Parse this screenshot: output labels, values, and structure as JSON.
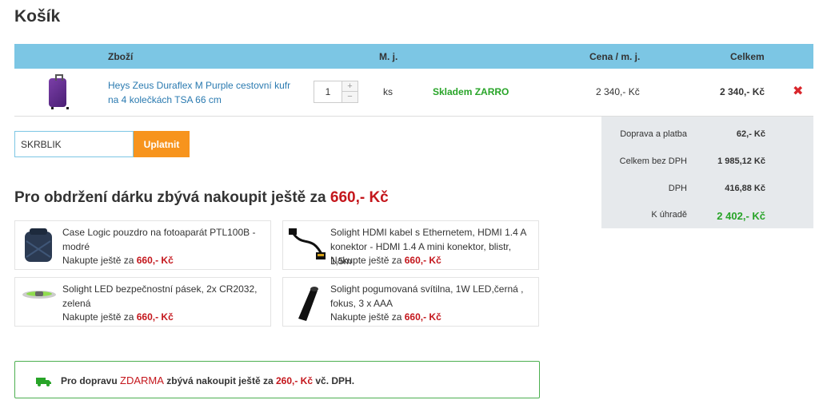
{
  "page": {
    "title": "Košík"
  },
  "cart": {
    "headers": {
      "product": "Zboží",
      "unit": "M. j.",
      "unit_price": "Cena / m. j.",
      "total": "Celkem"
    },
    "items": [
      {
        "name": "Heys Zeus Duraflex M Purple cestovní kufr na 4 kolečkách TSA 66 cm",
        "quantity": "1",
        "unit": "ks",
        "stock": "Skladem ZARRO",
        "unit_price": "2 340,- Kč",
        "total": "2 340,- Kč",
        "increase_symbol": "+",
        "decrease_symbol": "−",
        "remove_symbol": "✖"
      }
    ]
  },
  "coupon": {
    "value": "SKRBLIK",
    "button": "Uplatnit"
  },
  "summary": {
    "rows": [
      {
        "label": "Doprava a platba",
        "value": "62,- Kč"
      },
      {
        "label": "Celkem bez DPH",
        "value": "1 985,12 Kč"
      },
      {
        "label": "DPH",
        "value": "416,88 Kč"
      },
      {
        "label": "K úhradě",
        "value": "2 402,- Kč"
      }
    ]
  },
  "gift": {
    "title": "Pro obdržení dárku zbývá nakoupit ještě za",
    "amount": "660,- Kč",
    "cta_prefix": "Nakupte ještě za",
    "items": [
      {
        "name": "Case Logic pouzdro na fotoaparát PTL100B - modré",
        "amount": "660,- Kč",
        "icon": "camera-case-icon"
      },
      {
        "name": "Solight HDMI kabel s Ethernetem, HDMI 1.4 A konektor - HDMI 1.4 A mini konektor, blistr, 1,5m",
        "amount": "660,- Kč",
        "icon": "hdmi-cable-icon"
      },
      {
        "name": "Solight LED bezpečnostní pásek, 2x CR2032, zelená",
        "amount": "660,- Kč",
        "icon": "led-band-icon"
      },
      {
        "name": "Solight pogumovaná svítilna, 1W LED,černá , fokus, 3 x AAA",
        "amount": "660,- Kč",
        "icon": "flashlight-icon"
      }
    ]
  },
  "shipping": {
    "prefix": "Pro dopravu",
    "free": "ZDARMA",
    "middle": "zbývá nakoupit ještě za",
    "amount": "260,- Kč",
    "suffix": "vč. DPH."
  },
  "colors": {
    "header": "#7cc6e4",
    "accent": "#f7941d",
    "price_red": "#c4161c",
    "stock_green": "#28a428"
  }
}
